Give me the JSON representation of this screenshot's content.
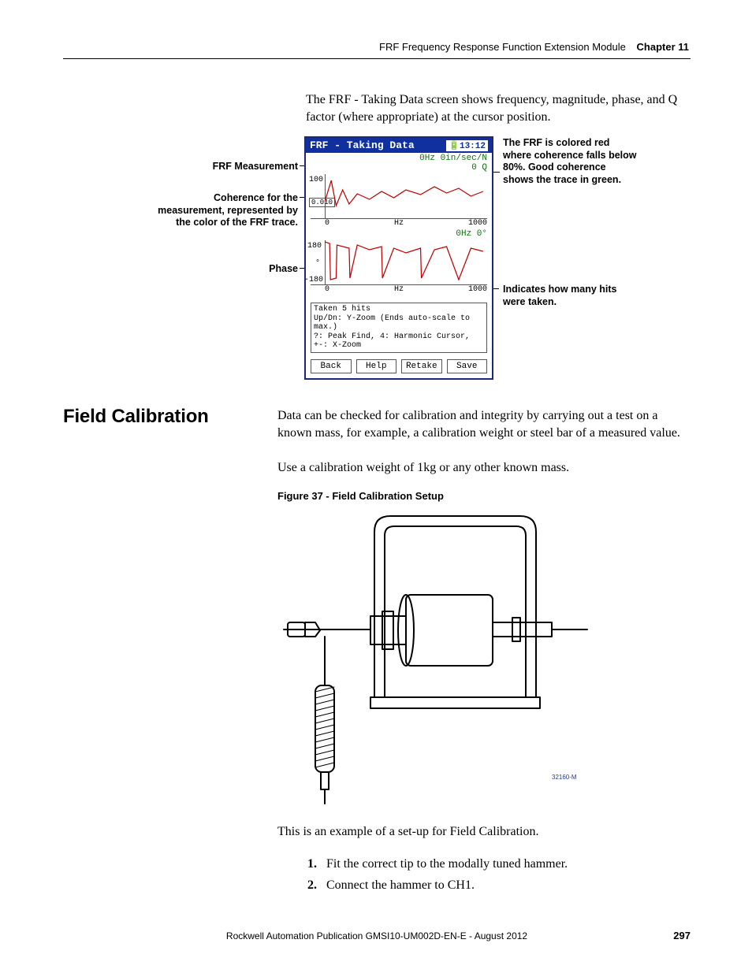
{
  "header": {
    "running_title": "FRF Frequency Response Function Extension Module",
    "chapter_label": "Chapter 11"
  },
  "intro_paragraph": "The FRF - Taking Data screen shows frequency, magnitude, phase, and Q factor (where appropriate) at the cursor position.",
  "diagram": {
    "callouts": {
      "frf_measurement": "FRF Measurement",
      "coherence": "Coherence for the measurement, represented by the color of the FRF trace.",
      "phase": "Phase",
      "trace_color": "The FRF is colored red where coherence falls below 80%. Good coherence shows the trace in green.",
      "hits": "Indicates how many hits were taken."
    },
    "device": {
      "title": "FRF - Taking Data",
      "clock": "13:12",
      "readout_top_line1": "0Hz  0in/sec/N",
      "readout_top_line2": "0 Q",
      "plot1": {
        "ytop": "100",
        "ylab_box": "0.010",
        "xunit": "Hz",
        "xmax": "1000",
        "xzero": "0"
      },
      "readout_mid": "0Hz  0°",
      "plot2": {
        "ytop": "180",
        "ymid": "°",
        "ybot": "-180",
        "xunit": "Hz",
        "xmax": "1000",
        "xzero": "0"
      },
      "info": {
        "line1": "Taken 5 hits",
        "line2": "Up/Dn: Y-Zoom (Ends auto-scale to max.)",
        "line3": "?: Peak Find, 4: Harmonic Cursor, +-: X-Zoom"
      },
      "buttons": {
        "back": "Back",
        "help": "Help",
        "retake": "Retake",
        "save": "Save"
      }
    }
  },
  "section": {
    "heading": "Field Calibration",
    "para1": "Data can be checked for calibration and integrity by carrying out a test on a known mass, for example, a calibration weight or steel bar of a measured value.",
    "para2": "Use a calibration weight of 1kg or any other known mass.",
    "figure_caption": "Figure 37 - Field Calibration Setup",
    "figure_id": "32160-M",
    "para3": "This is an example of a set-up for Field Calibration.",
    "steps": {
      "n1": "1.",
      "s1": "Fit the correct tip to the modally tuned hammer.",
      "n2": "2.",
      "s2": "Connect the hammer to CH1."
    }
  },
  "footer": {
    "publication": "Rockwell Automation Publication GMSI10-UM002D-EN-E - August 2012",
    "page_number": "297"
  }
}
